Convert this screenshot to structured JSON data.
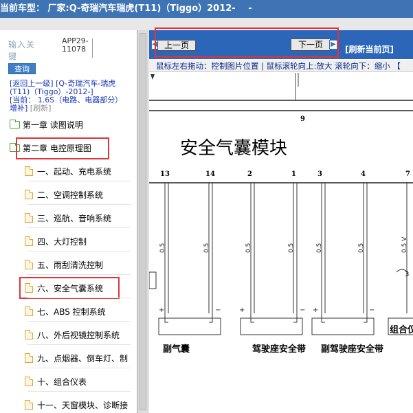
{
  "titlebar": {
    "text": "当前车型：  厂家:Q-奇瑞汽车瑞虎(T11)（Tiggo）2012-",
    "trail": "-"
  },
  "search": {
    "label": "输入关键",
    "button": "查询"
  },
  "app_code": "APP29-11078",
  "breadcrumb": {
    "back": "[返回上一级]",
    "vehicle": "[Q-奇瑞汽车-瑞虎(T11)（Tiggo）-2012-]",
    "current_prefix": "[当前：",
    "current": "1.6S（电路、电器部分）增补]",
    "refresh": "[刷新]"
  },
  "tree": [
    {
      "type": "folder",
      "label": "第一章 读图说明"
    },
    {
      "type": "folder",
      "label": "第二章 电控原理图",
      "highlighted": true
    },
    {
      "type": "page",
      "label": "一、起动、充电系统"
    },
    {
      "type": "page",
      "label": "二、空调控制系统"
    },
    {
      "type": "page",
      "label": "三、巡航、音响系统"
    },
    {
      "type": "page",
      "label": "四、大灯控制"
    },
    {
      "type": "page",
      "label": "五、雨刮清洗控制"
    },
    {
      "type": "page",
      "label": "六、安全气囊系统",
      "highlighted": true
    },
    {
      "type": "page",
      "label": "七、ABS 控制系统"
    },
    {
      "type": "page",
      "label": "八、外后视镜控制系统"
    },
    {
      "type": "page",
      "label": "九、点烟器、倒车灯、制"
    },
    {
      "type": "page",
      "label": "十、组合仪表"
    },
    {
      "type": "page",
      "label": "十一、天窗模块、诊断接"
    }
  ],
  "nav": {
    "prev": "上一页",
    "next": "下一页",
    "refresh": "[刷新当前页]"
  },
  "hint": "鼠标左右拖动：控制图片位置 | 鼠标滚轮向上:放大  滚轮向下：缩小 【",
  "diagram": {
    "title": "安全气囊模块",
    "connector_no": "9",
    "pins": [
      "13",
      "14",
      "2",
      "1",
      "3",
      "4",
      "7"
    ],
    "wire_sizes": [
      "0.5",
      "0.5",
      "0.5",
      "0.5",
      "0.5",
      "0.5",
      "0.5 V"
    ],
    "loop_mark": "3",
    "labels": [
      "副气囊",
      "驾驶座安全带",
      "副驾驶座安全带",
      "组合仪"
    ]
  },
  "colors": {
    "titlebar": "#3f74b4",
    "navbar": "#2c66b8",
    "highlight": "#e0343a",
    "link": "#1a35b8"
  }
}
